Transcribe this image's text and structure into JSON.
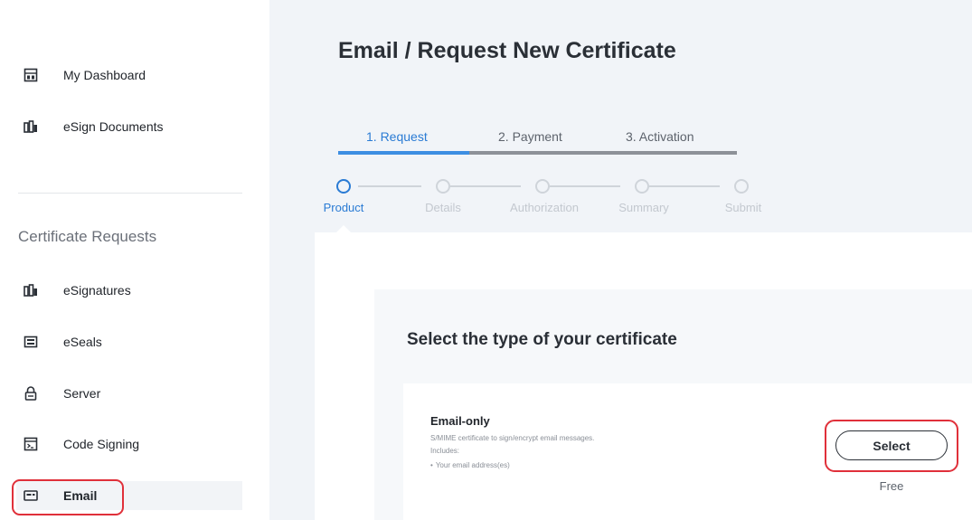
{
  "sidebar": {
    "items_top": [
      {
        "label": "My Dashboard",
        "icon": "dashboard-icon"
      },
      {
        "label": "eSign Documents",
        "icon": "esign-documents-icon"
      }
    ],
    "section_title": "Certificate Requests",
    "items_certs": [
      {
        "label": "eSignatures",
        "icon": "esignatures-icon"
      },
      {
        "label": "eSeals",
        "icon": "eseals-icon"
      },
      {
        "label": "Server",
        "icon": "lock-icon"
      },
      {
        "label": "Code Signing",
        "icon": "code-signing-icon"
      },
      {
        "label": "Email",
        "icon": "email-icon",
        "active": true
      }
    ]
  },
  "main": {
    "title": "Email / Request New Certificate",
    "tabs": [
      {
        "label": "1. Request",
        "active": true
      },
      {
        "label": "2. Payment",
        "active": false
      },
      {
        "label": "3. Activation",
        "active": false
      }
    ],
    "steps": [
      {
        "label": "Product",
        "active": true
      },
      {
        "label": "Details",
        "active": false
      },
      {
        "label": "Authorization",
        "active": false
      },
      {
        "label": "Summary",
        "active": false
      },
      {
        "label": "Submit",
        "active": false
      }
    ],
    "section_title": "Select the type of your certificate",
    "option": {
      "name": "Email-only",
      "description": "S/MIME certificate to sign/encrypt email messages.",
      "includes_label": "Includes:",
      "features": [
        "Your email address(es)"
      ],
      "button_label": "Select",
      "price": "Free"
    }
  },
  "colors": {
    "accent": "#2a7bd4",
    "highlight": "#e0303a",
    "background": "#f1f4f8"
  }
}
